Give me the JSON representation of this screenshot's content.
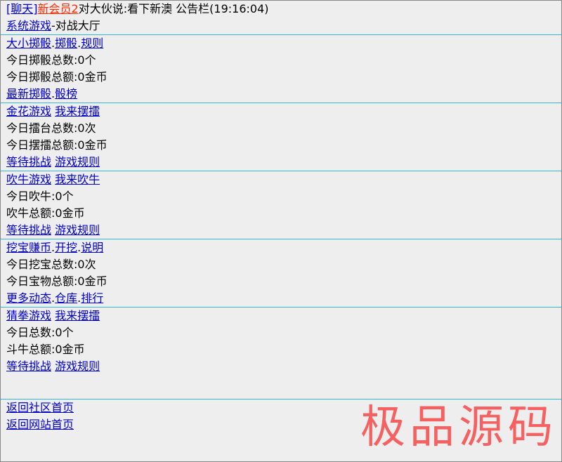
{
  "notice": {
    "chat_link": "[聊天]",
    "user_link": "新会员2",
    "message": "对大伙说:看下新澳 公告栏(19:16:04)"
  },
  "hall": {
    "link": "系统游戏",
    "suffix": "-对战大厅"
  },
  "dice": {
    "links": [
      "大小掷骰",
      "掷骰",
      "规则"
    ],
    "count": "今日掷骰总数:0个",
    "amount": "今日掷骰总额:0金币",
    "bottom_links": [
      "最新掷骰",
      "骰榜"
    ]
  },
  "golden_flower": {
    "title_link": "金花游戏",
    "action_link": "我来摆擂",
    "count": "今日擂台总数:0次",
    "amount": "今日摆擂总额:0金币",
    "wait_link": "等待挑战",
    "rules_link": "游戏规则"
  },
  "brag": {
    "title_link": "吹牛游戏",
    "action_link": "我来吹牛",
    "count": "今日吹牛:0个",
    "amount": "吹牛总额:0金币",
    "wait_link": "等待挑战",
    "rules_link": "游戏规则"
  },
  "treasure": {
    "links": [
      "挖宝赚币",
      "开挖",
      "说明"
    ],
    "count": "今日挖宝总数:0次",
    "amount": "今日宝物总额:0金币",
    "bottom_links": [
      "更多动态",
      "仓库",
      "排行"
    ]
  },
  "guess_fist": {
    "title_link": "猜拳游戏",
    "action_link": "我来摆擂",
    "count": "今日总数:0个",
    "amount": "斗牛总额:0金币",
    "wait_link": "等待挑战",
    "rules_link": "游戏规则"
  },
  "footer": {
    "community_link": "返回社区首页",
    "site_link": "返回网站首页"
  },
  "watermark": "极品源码"
}
